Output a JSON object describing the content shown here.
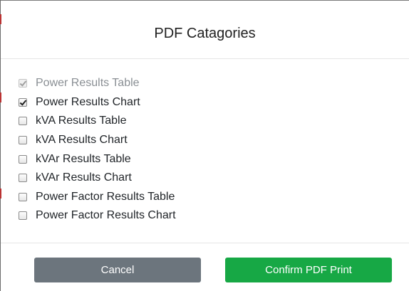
{
  "dialog": {
    "title": "PDF Catagories"
  },
  "options": [
    {
      "label": "Power Results Table",
      "checked": true,
      "disabled": true
    },
    {
      "label": "Power Results Chart",
      "checked": true,
      "disabled": false
    },
    {
      "label": "kVA Results Table",
      "checked": false,
      "disabled": false
    },
    {
      "label": "kVA Results Chart",
      "checked": false,
      "disabled": false
    },
    {
      "label": "kVAr Results Table",
      "checked": false,
      "disabled": false
    },
    {
      "label": "kVAr Results Chart",
      "checked": false,
      "disabled": false
    },
    {
      "label": "Power Factor Results Table",
      "checked": false,
      "disabled": false
    },
    {
      "label": "Power Factor Results Chart",
      "checked": false,
      "disabled": false
    }
  ],
  "footer": {
    "cancel_label": "Cancel",
    "confirm_label": "Confirm PDF Print"
  },
  "colors": {
    "cancel_button": "#6c757d",
    "confirm_button": "#17a845"
  }
}
